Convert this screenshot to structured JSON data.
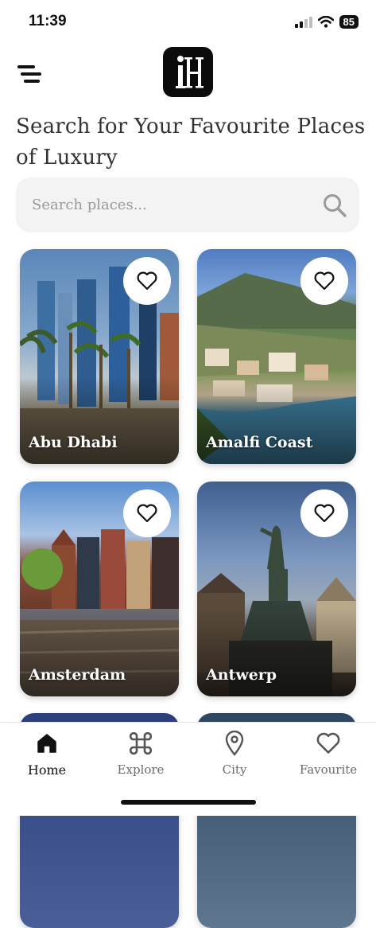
{
  "status_bar": {
    "time": "11:39",
    "battery": "85"
  },
  "header": {
    "logo_text": "iH",
    "menu_icon": "menu-icon"
  },
  "headline": "Search for Your Favourite Places of Luxury",
  "search": {
    "placeholder": "Search places...",
    "value": ""
  },
  "places": [
    {
      "name": "Abu Dhabi",
      "favourite": false
    },
    {
      "name": "Amalfi Coast",
      "favourite": false
    },
    {
      "name": "Amsterdam",
      "favourite": false
    },
    {
      "name": "Antwerp",
      "favourite": false
    }
  ],
  "tabs": [
    {
      "label": "Home",
      "icon": "home-icon",
      "active": true
    },
    {
      "label": "Explore",
      "icon": "command-icon",
      "active": false
    },
    {
      "label": "City",
      "icon": "location-pin-icon",
      "active": false
    },
    {
      "label": "Favourite",
      "icon": "heart-icon",
      "active": false
    }
  ],
  "colors": {
    "active_tab": "#111111",
    "inactive_tab": "#6b6b6b",
    "search_bg": "#f3f3f3"
  }
}
